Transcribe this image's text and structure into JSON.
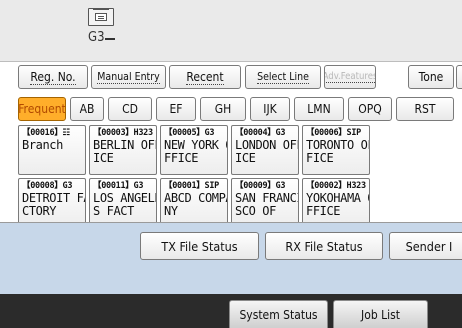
{
  "display": {
    "line_label": "G3"
  },
  "toolbar": {
    "reg_no": "Reg. No.",
    "manual_entry": "Manual Entry",
    "recent": "Recent",
    "select_line": "Select Line",
    "adv_features": "Adv.Features",
    "tone": "Tone"
  },
  "title_tabs": [
    "Frequent",
    "AB",
    "CD",
    "EF",
    "GH",
    "IJK",
    "LMN",
    "OPQ",
    "RST"
  ],
  "destinations": [
    {
      "code": "【00016】",
      "line": "",
      "name": "Branch"
    },
    {
      "code": "【00003】",
      "line": "H323",
      "name": "BERLIN OFF\nICE"
    },
    {
      "code": "【00005】",
      "line": "G3",
      "name": "NEW YORK O\nFFICE"
    },
    {
      "code": "【00004】",
      "line": "G3",
      "name": "LONDON OFF\nICE"
    },
    {
      "code": "【00006】",
      "line": "SIP",
      "name": "TORONTO OF\nFICE"
    },
    {
      "code": "【00008】",
      "line": "G3",
      "name": "DETROIT FA\nCTORY"
    },
    {
      "code": "【00011】",
      "line": "G3",
      "name": "LOS ANGELE\nS FACT"
    },
    {
      "code": "【00001】",
      "line": "SIP",
      "name": "ABCD COMPA\nNY"
    },
    {
      "code": "【00009】",
      "line": "G3",
      "name": "SAN FRANCI\nSCO OF"
    },
    {
      "code": "【00002】",
      "line": "H323",
      "name": "YOKOHAMA O\nFFICE"
    }
  ],
  "status_buttons": {
    "tx_file_status": "TX File Status",
    "rx_file_status": "RX File Status",
    "sender": "Sender I"
  },
  "footer": {
    "system_status": "System Status",
    "job_list": "Job List"
  },
  "colors": {
    "active_tab": "#ffae2a",
    "status_area": "#c7d7e9",
    "footer": "#2b2b2b"
  }
}
